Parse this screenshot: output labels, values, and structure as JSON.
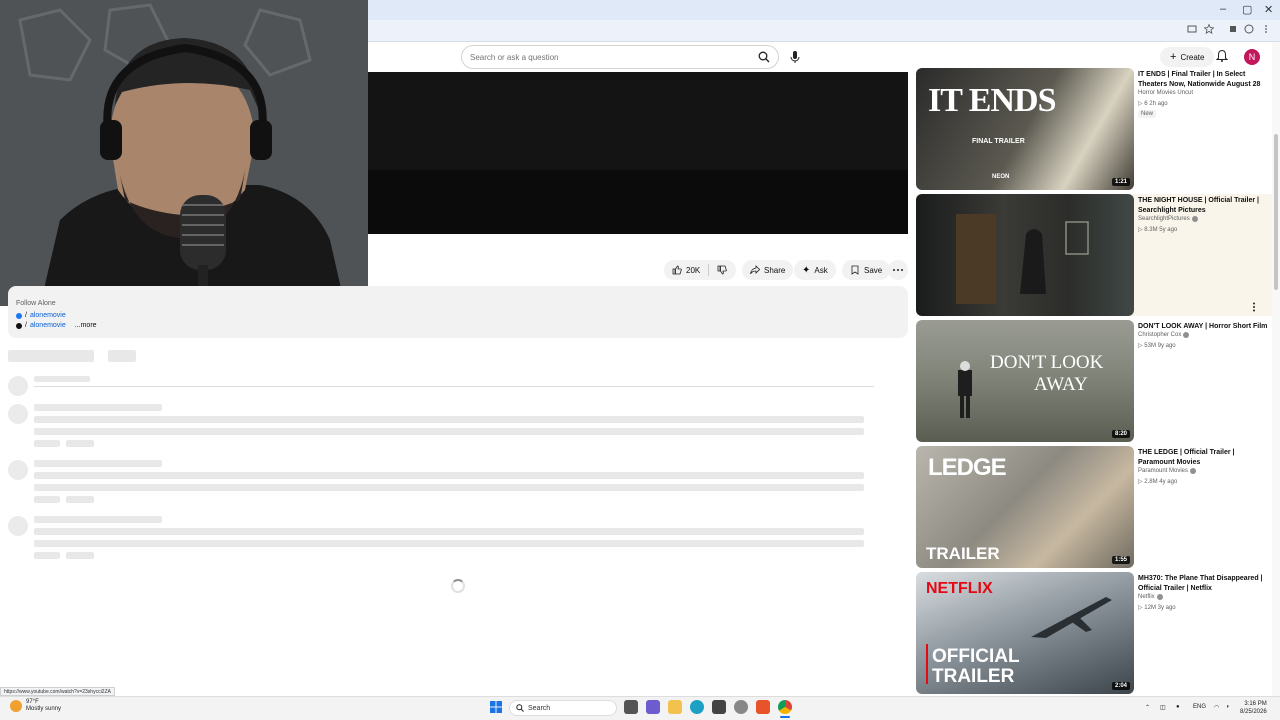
{
  "browser": {
    "window_controls": [
      "–",
      "▢",
      "✕"
    ]
  },
  "header": {
    "search_placeholder": "Search or ask a question",
    "create_label": "Create",
    "avatar_letter": "N"
  },
  "actions": {
    "like_count": "20K",
    "share_label": "Share",
    "ask_label": "Ask",
    "save_label": "Save"
  },
  "description": {
    "line0": "Follow Alone",
    "line1_prefix": "/",
    "line1_link": "alonemovie",
    "line2_prefix": "/",
    "line2_link": "alonemovie",
    "more_label": "...more"
  },
  "recommendations": [
    {
      "title": "IT ENDS | Final Trailer | In Select Theaters Now, Nationwide August 28",
      "channel": "Horror Movies Uncut",
      "meta": "▷ 6  2h ago",
      "badge": "New",
      "duration": "1:21",
      "thumb_text": "IT ENDS",
      "thumb_sub": "FINAL TRAILER",
      "thumb_logo": "NEON"
    },
    {
      "title": "THE NIGHT HOUSE | Official Trailer | Searchlight Pictures",
      "channel": "SearchlightPictures",
      "meta": "▷ 8.3M  5y ago",
      "duration": ""
    },
    {
      "title": "DON'T LOOK AWAY | Horror Short Film",
      "channel": "Christopher Cox",
      "meta": "▷ 53M  9y ago",
      "duration": "8:20",
      "thumb_text_1": "DON'T LOOK",
      "thumb_text_2": "AWAY"
    },
    {
      "title": "THE LEDGE | Official Trailer | Paramount Movies",
      "channel": "Paramount Movies",
      "meta": "▷ 2.8M  4y ago",
      "duration": "1:55",
      "thumb_text_1": "LEDGE",
      "thumb_text_2": "TRAILER"
    },
    {
      "title": "MH370: The Plane That Disappeared | Official Trailer | Netflix",
      "channel": "Netflix",
      "meta": "▷ 12M  3y ago",
      "duration": "2:04",
      "thumb_text_1": "NETFLIX",
      "thumb_text_2": "OFFICIAL",
      "thumb_text_3": "TRAILER"
    }
  ],
  "status_url": "https://www.youtube.com/watch?v=23shycci2ZA",
  "taskbar": {
    "temperature": "97°F",
    "weather": "Mostly sunny",
    "search_label": "Search",
    "language": "ENG",
    "time": "3:16 PM",
    "date": "8/25/2026"
  },
  "colors": {
    "accent": "#c2185b",
    "link": "#065fd4",
    "highlight": "#f9f5ea"
  }
}
